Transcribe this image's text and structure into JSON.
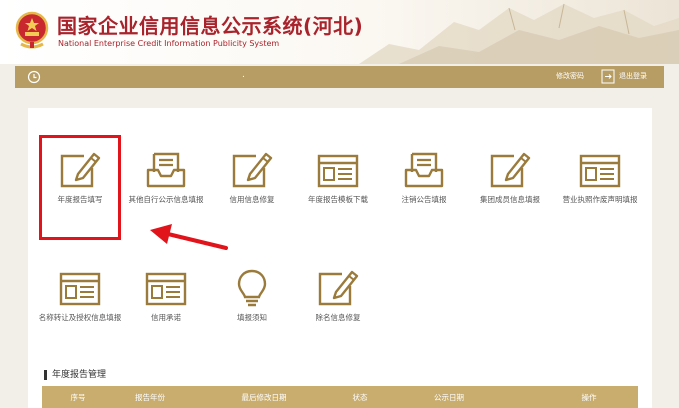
{
  "header": {
    "title": "国家企业信用信息公示系统(河北)",
    "subtitle": "National Enterprise Credit Information Publicity System"
  },
  "toolbar": {
    "dot": ".",
    "change_password": "修改密码",
    "logout": "退出登录"
  },
  "tiles_row1": [
    {
      "label": "年度报告填写",
      "icon": "pencil-square-icon"
    },
    {
      "label": "其他自行公示信息填报",
      "icon": "inbox-tray-icon"
    },
    {
      "label": "信用信息修复",
      "icon": "pencil-square-icon"
    },
    {
      "label": "年度报告模板下载",
      "icon": "browser-window-icon"
    },
    {
      "label": "注销公告填报",
      "icon": "inbox-tray-icon"
    },
    {
      "label": "集团成员信息填报",
      "icon": "pencil-square-icon"
    },
    {
      "label": "营业执照作废声明填报",
      "icon": "browser-window-icon"
    }
  ],
  "tiles_row2": [
    {
      "label": "名称转让及授权信息填报",
      "icon": "browser-window-icon"
    },
    {
      "label": "信用承诺",
      "icon": "browser-window-icon"
    },
    {
      "label": "填报须知",
      "icon": "lightbulb-icon"
    },
    {
      "label": "除名信息修复",
      "icon": "pencil-square-icon"
    }
  ],
  "annual_reports": {
    "section_title": "年度报告管理",
    "columns": [
      "序号",
      "报告年份",
      "最后修改日期",
      "状态",
      "公示日期",
      "操作"
    ]
  },
  "colors": {
    "brand_red": "#a8232b",
    "gold": "#b79d64",
    "icon_gold": "#9a7b3c",
    "highlight_red": "#e1141c"
  }
}
